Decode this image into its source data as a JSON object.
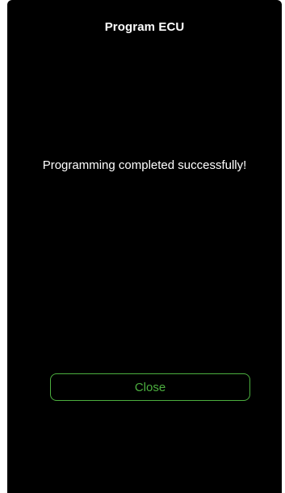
{
  "header": {
    "title": "Program ECU"
  },
  "main": {
    "message": "Programming completed successfully!"
  },
  "actions": {
    "close_label": "Close"
  },
  "colors": {
    "background": "#000000",
    "text": "#ffffff",
    "accent": "#4caf3f"
  }
}
